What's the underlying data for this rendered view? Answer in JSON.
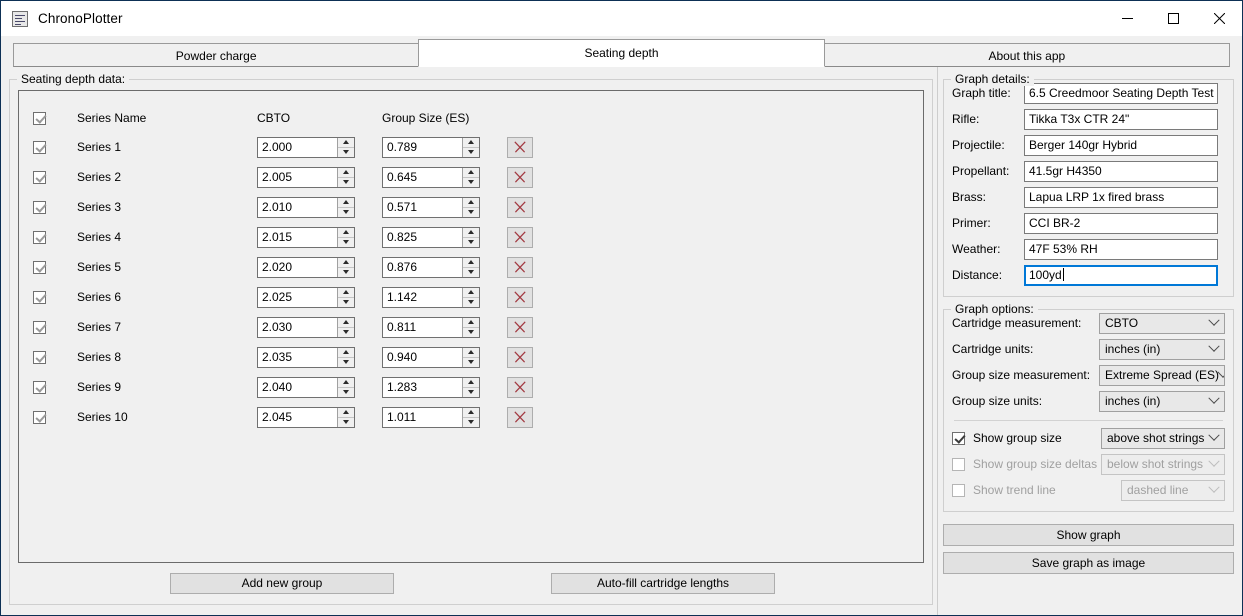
{
  "window": {
    "title": "ChronoPlotter",
    "icon": "document-lines-icon",
    "minimize_label": "minimize-icon",
    "maximize_label": "maximize-icon",
    "close_label": "close-icon"
  },
  "tabs": [
    {
      "label": "Powder charge",
      "active": false
    },
    {
      "label": "Seating depth",
      "active": true
    },
    {
      "label": "About this app",
      "active": false
    }
  ],
  "left_panel": {
    "group_title": "Seating depth data:",
    "columns": {
      "series_name": "Series Name",
      "cbto": "CBTO",
      "group_size": "Group Size (ES)"
    },
    "rows": [
      {
        "checked": true,
        "name": "Series 1",
        "cbto": "2.000",
        "group_size": "0.789"
      },
      {
        "checked": true,
        "name": "Series 2",
        "cbto": "2.005",
        "group_size": "0.645"
      },
      {
        "checked": true,
        "name": "Series 3",
        "cbto": "2.010",
        "group_size": "0.571"
      },
      {
        "checked": true,
        "name": "Series 4",
        "cbto": "2.015",
        "group_size": "0.825"
      },
      {
        "checked": true,
        "name": "Series 5",
        "cbto": "2.020",
        "group_size": "0.876"
      },
      {
        "checked": true,
        "name": "Series 6",
        "cbto": "2.025",
        "group_size": "1.142"
      },
      {
        "checked": true,
        "name": "Series 7",
        "cbto": "2.030",
        "group_size": "0.811"
      },
      {
        "checked": true,
        "name": "Series 8",
        "cbto": "2.035",
        "group_size": "0.940"
      },
      {
        "checked": true,
        "name": "Series 9",
        "cbto": "2.040",
        "group_size": "1.283"
      },
      {
        "checked": true,
        "name": "Series 10",
        "cbto": "2.045",
        "group_size": "1.011"
      }
    ],
    "delete_icon": "red-x-icon",
    "buttons": {
      "add_group": "Add new group",
      "autofill": "Auto-fill cartridge lengths"
    }
  },
  "graph_details": {
    "group_title": "Graph details:",
    "fields": [
      {
        "label": "Graph title:",
        "value": "6.5 Creedmoor Seating Depth Test",
        "focused": false
      },
      {
        "label": "Rifle:",
        "value": "Tikka T3x CTR 24\"",
        "focused": false
      },
      {
        "label": "Projectile:",
        "value": "Berger 140gr Hybrid",
        "focused": false
      },
      {
        "label": "Propellant:",
        "value": "41.5gr H4350",
        "focused": false
      },
      {
        "label": "Brass:",
        "value": "Lapua LRP 1x fired brass",
        "focused": false
      },
      {
        "label": "Primer:",
        "value": "CCI BR-2",
        "focused": false
      },
      {
        "label": "Weather:",
        "value": "47F 53% RH",
        "focused": false
      },
      {
        "label": "Distance:",
        "value": "100yd",
        "focused": true
      }
    ]
  },
  "graph_options": {
    "group_title": "Graph options:",
    "selects": [
      {
        "label": "Cartridge measurement:",
        "value": "CBTO"
      },
      {
        "label": "Cartridge units:",
        "value": "inches (in)"
      },
      {
        "label": "Group size measurement:",
        "value": "Extreme Spread (ES)"
      },
      {
        "label": "Group size units:",
        "value": "inches (in)"
      }
    ],
    "toggles": [
      {
        "label": "Show group size",
        "checked": true,
        "disabled": false,
        "select_value": "above shot strings",
        "select_disabled": false
      },
      {
        "label": "Show group size deltas",
        "checked": false,
        "disabled": true,
        "select_value": "below shot strings",
        "select_disabled": true
      },
      {
        "label": "Show trend line",
        "checked": false,
        "disabled": true,
        "select_value": "dashed line",
        "select_disabled": true
      }
    ]
  },
  "actions": {
    "show_graph": "Show graph",
    "save_graph": "Save graph as image"
  },
  "colors": {
    "window_border": "#0d3055",
    "panel_bg": "#f0f0f0",
    "delete_x": "#a33a42",
    "focus_blue": "#0078d7"
  }
}
